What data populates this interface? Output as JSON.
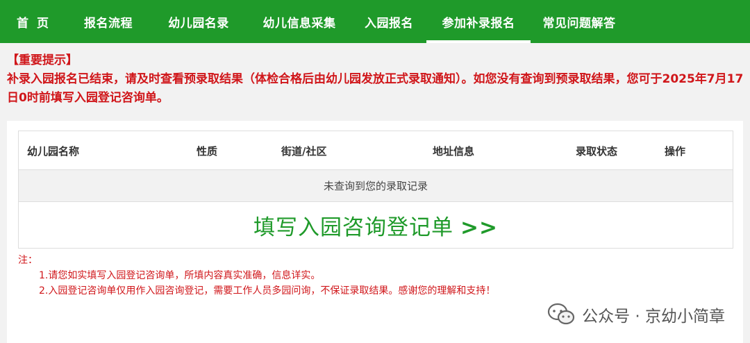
{
  "nav": {
    "items": [
      {
        "label": "首页"
      },
      {
        "label": "报名流程"
      },
      {
        "label": "幼儿园名录"
      },
      {
        "label": "幼儿信息采集"
      },
      {
        "label": "入园报名"
      },
      {
        "label": "参加补录报名"
      },
      {
        "label": "常见问题解答"
      }
    ],
    "active_index": 5,
    "background": "#1f9a2a"
  },
  "notice": {
    "title": "【重要提示】",
    "body": "补录入园报名已结束，请及时查看预录取结果（体检合格后由幼儿园发放正式录取通知）。如您没有查询到预录取结果，您可于2025年7月17日0时前填写入园登记咨询单。",
    "color": "#d0161a"
  },
  "table": {
    "columns": [
      "幼儿园名称",
      "性质",
      "街道/社区",
      "地址信息",
      "录取状态",
      "操作"
    ],
    "empty_text": "未查询到您的录取记录"
  },
  "register_link": {
    "label": "填写入园咨询登记单",
    "arrows": ">>"
  },
  "notes": {
    "heading": "注：",
    "items": [
      "1.请您如实填写入园登记咨询单，所填内容真实准确，信息详实。",
      "2.入园登记咨询单仅用作入园咨询登记，需要工作人员多园问询，不保证录取结果。感谢您的理解和支持！"
    ]
  },
  "watermark": {
    "icon": "wechat-icon",
    "text": "公众号 · 京幼小简章"
  }
}
